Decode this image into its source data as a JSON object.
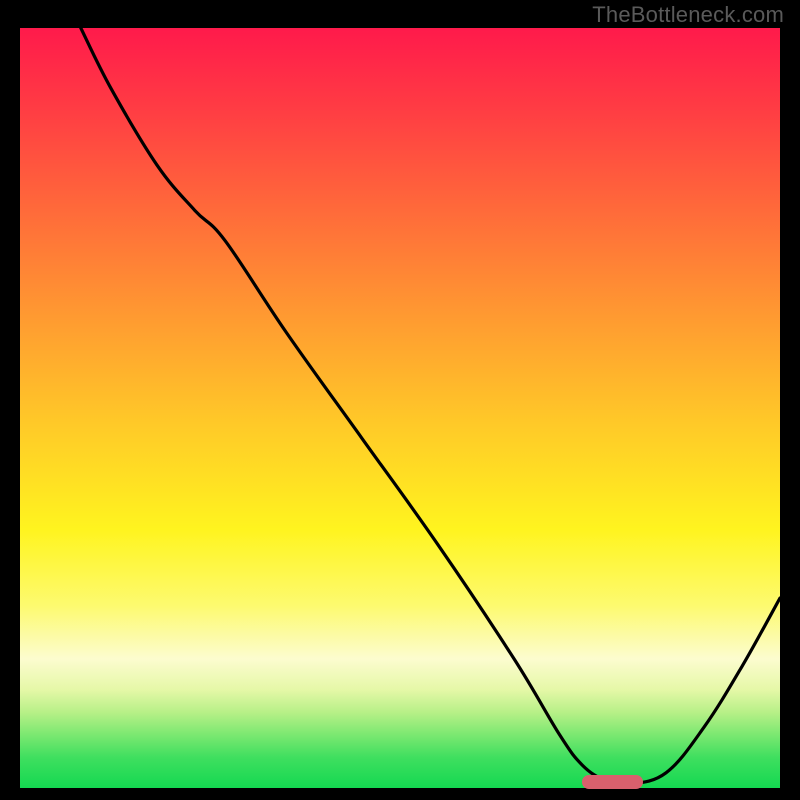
{
  "watermark": "TheBottleneck.com",
  "colors": {
    "curve": "#000000",
    "marker": "#d9606d",
    "frame": "#000000"
  },
  "chart_data": {
    "type": "line",
    "title": "",
    "xlabel": "",
    "ylabel": "",
    "xlim": [
      0,
      100
    ],
    "ylim": [
      0,
      100
    ],
    "series": [
      {
        "name": "curve",
        "x": [
          8,
          12,
          18,
          23,
          27,
          35,
          45,
          55,
          65,
          71,
          74,
          77,
          80,
          85,
          90,
          95,
          100
        ],
        "y": [
          100,
          92,
          82,
          76,
          72,
          60,
          46,
          32,
          17,
          7,
          3,
          1,
          0.5,
          2,
          8,
          16,
          25
        ]
      }
    ],
    "marker": {
      "x_start": 74,
      "x_end": 82,
      "y": 0.8
    }
  }
}
